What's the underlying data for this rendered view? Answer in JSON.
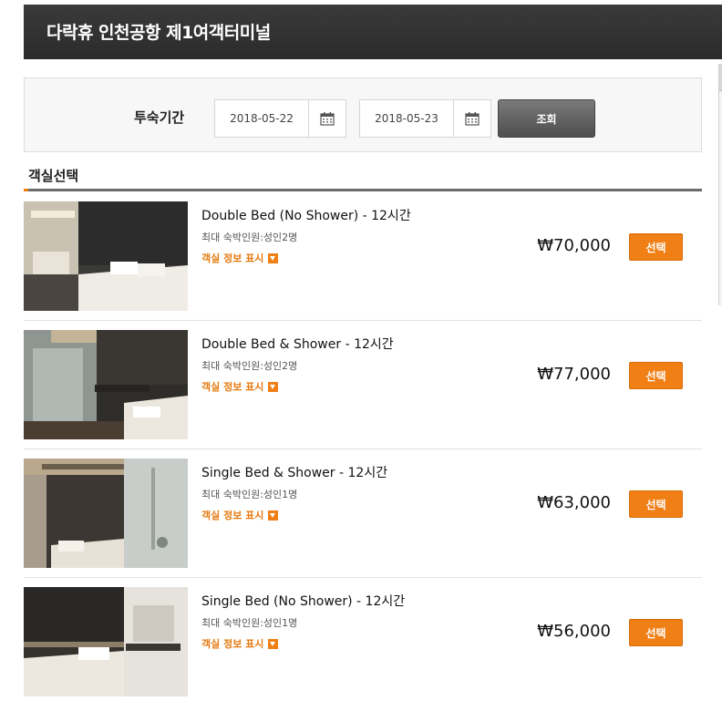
{
  "header": {
    "title": "다락휴 인천공항 제1여객터미널"
  },
  "search": {
    "label": "투숙기간",
    "check_in": "2018-05-22",
    "check_out": "2018-05-23",
    "button_label": "조회"
  },
  "section": {
    "title": "객실선택"
  },
  "rooms": [
    {
      "name": "Double Bed (No Shower) - 12시간",
      "capacity": "최대 숙박인원:성인2명",
      "info_label": "객실 정보 표시",
      "price": "₩70,000",
      "select_label": "선택"
    },
    {
      "name": "Double Bed & Shower - 12시간",
      "capacity": "최대 숙박인원:성인2명",
      "info_label": "객실 정보 표시",
      "price": "₩77,000",
      "select_label": "선택"
    },
    {
      "name": "Single Bed & Shower - 12시간",
      "capacity": "최대 숙박인원:성인1명",
      "info_label": "객실 정보 표시",
      "price": "₩63,000",
      "select_label": "선택"
    },
    {
      "name": "Single Bed (No Shower) - 12시간",
      "capacity": "최대 숙박인원:성인1명",
      "info_label": "객실 정보 표시",
      "price": "₩56,000",
      "select_label": "선택"
    }
  ],
  "colors": {
    "accent": "#f07f16",
    "header_bg": "#2f2f2f",
    "search_button": "#5a5a5a"
  },
  "icons": {
    "calendar": "calendar-icon",
    "info": "dropdown-arrow-icon"
  }
}
